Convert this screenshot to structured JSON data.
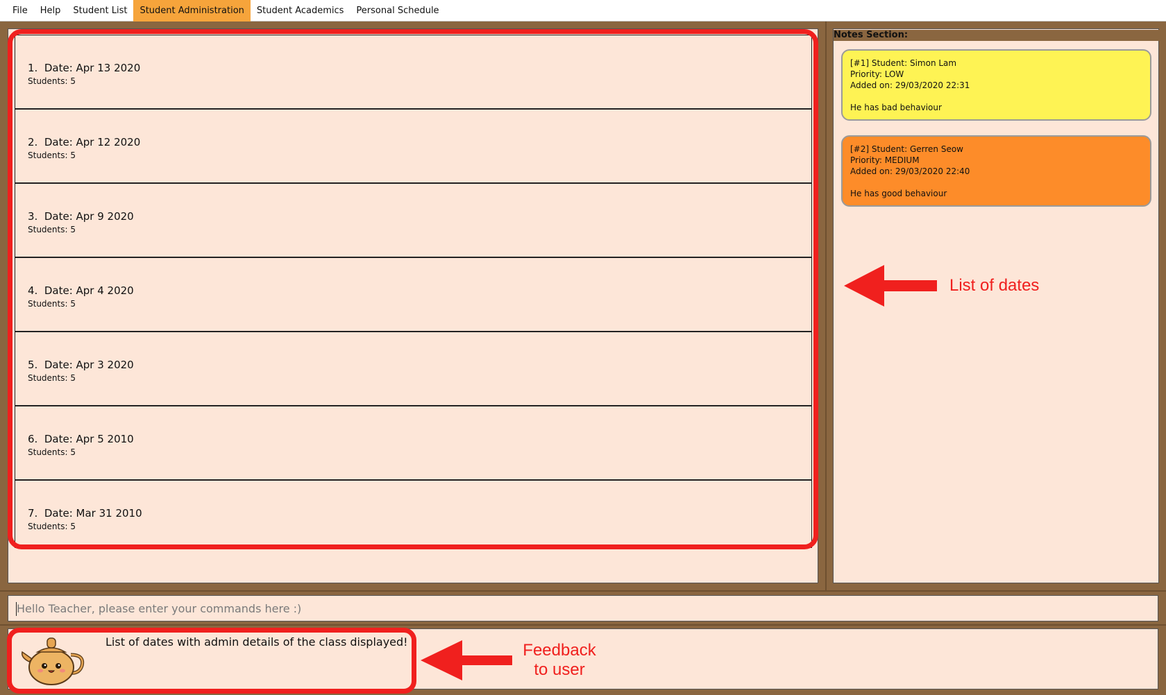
{
  "menu": {
    "items": [
      {
        "label": "File",
        "active": false
      },
      {
        "label": "Help",
        "active": false
      },
      {
        "label": "Student List",
        "active": false
      },
      {
        "label": "Student Administration",
        "active": true
      },
      {
        "label": "Student Academics",
        "active": false
      },
      {
        "label": "Personal Schedule",
        "active": false
      }
    ]
  },
  "dates": {
    "items": [
      {
        "title": "1.  Date: Apr 13 2020",
        "students": "Students: 5"
      },
      {
        "title": "2.  Date: Apr 12 2020",
        "students": "Students: 5"
      },
      {
        "title": "3.  Date: Apr 9 2020",
        "students": "Students: 5"
      },
      {
        "title": "4.  Date: Apr 4 2020",
        "students": "Students: 5"
      },
      {
        "title": "5.  Date: Apr 3 2020",
        "students": "Students: 5"
      },
      {
        "title": "6.  Date: Apr 5 2010",
        "students": "Students: 5"
      },
      {
        "title": "7.  Date: Mar 31 2010",
        "students": "Students: 5"
      }
    ]
  },
  "notes": {
    "header": "Notes Section:",
    "cards": [
      {
        "student": "[#1] Student: Simon Lam",
        "priority": "Priority: LOW",
        "added": "Added on: 29/03/2020 22:31",
        "content": "He has bad behaviour",
        "color": "#fef354"
      },
      {
        "student": "[#2] Student: Gerren Seow",
        "priority": "Priority: MEDIUM",
        "added": "Added on: 29/03/2020 22:40",
        "content": "He has good behaviour",
        "color": "#fd8c29"
      }
    ]
  },
  "command": {
    "placeholder": "Hello Teacher, please enter your commands here :)",
    "value": ""
  },
  "feedback": {
    "message": "List of dates with admin details of the class displayed!"
  },
  "annotations": {
    "list_label": "List of dates",
    "feedback_label_line1": "Feedback",
    "feedback_label_line2": "to user",
    "color": "#f0201e"
  },
  "colors": {
    "background": "#8a6640",
    "panel": "#fde6d8",
    "menu_active": "#f6a43b"
  }
}
